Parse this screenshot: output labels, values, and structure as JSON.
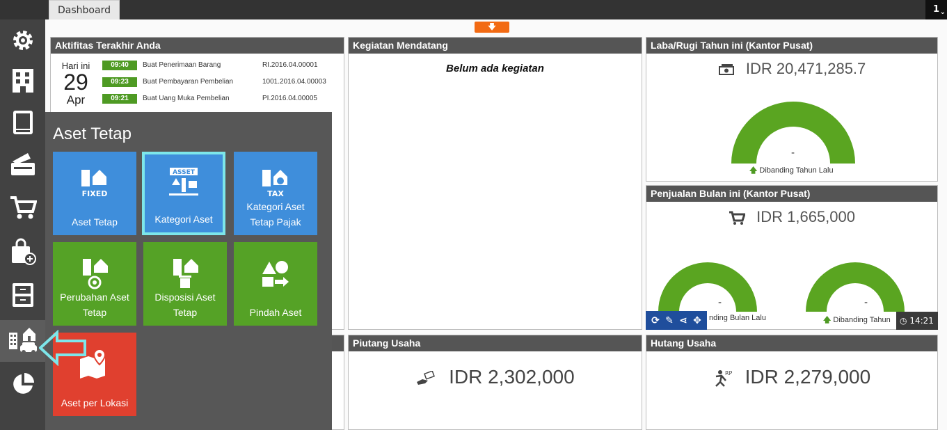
{
  "topbar": {
    "tab_label": "Dashboard",
    "window_num": "1"
  },
  "sidebar": {
    "items": [
      {
        "icon": "gear-icon"
      },
      {
        "icon": "building-icon"
      },
      {
        "icon": "book-icon"
      },
      {
        "icon": "wallet-icon"
      },
      {
        "icon": "cart-icon"
      },
      {
        "icon": "bag-add-icon"
      },
      {
        "icon": "cabinet-icon"
      },
      {
        "icon": "assets-icon"
      },
      {
        "icon": "pie-chart-icon"
      }
    ],
    "active_index": 7
  },
  "panels": {
    "aktifitas": {
      "title": "Aktifitas Terakhir Anda",
      "date_label": "Hari ini",
      "date_day": "29",
      "date_month": "Apr",
      "rows": [
        {
          "time": "09:40",
          "desc": "Buat Penerimaan Barang",
          "ref": "RI.2016.04.00001"
        },
        {
          "time": "09:23",
          "desc": "Buat Pembayaran Pembelian",
          "ref": "1001.2016.04.00003"
        },
        {
          "time": "09:21",
          "desc": "Buat Uang Muka Pembelian",
          "ref": "PI.2016.04.00005"
        }
      ]
    },
    "kegiatan": {
      "title": "Kegiatan Mendatang",
      "empty_text": "Belum ada kegiatan"
    },
    "laba": {
      "title": "Laba/Rugi Tahun ini (Kantor Pusat)",
      "amount": "IDR 20,471,285.7",
      "gauge_value": "-",
      "compare": "Dibanding Tahun Lalu"
    },
    "penjualan": {
      "title": "Penjualan Bulan ini (Kantor Pusat)",
      "amount": "IDR 1,665,000",
      "gauge1_value": "-",
      "gauge2_value": "-",
      "compare1": "nding Bulan Lalu",
      "compare2": "Dibanding Tahun",
      "time": "14:21"
    },
    "piutang": {
      "title": "Piutang Usaha",
      "amount": "IDR 2,302,000"
    },
    "hutang": {
      "title": "Hutang Usaha",
      "amount": "IDR 2,279,000"
    }
  },
  "menu": {
    "title": "Aset Tetap",
    "tiles": [
      {
        "label": "Aset Tetap",
        "badge": "FIXED",
        "color": "#3f8edb"
      },
      {
        "label": "Kategori Aset",
        "badge": "ASSET",
        "color": "#3f8edb",
        "selected": true
      },
      {
        "label": "Kategori Aset Tetap Pajak",
        "badge": "TAX",
        "color": "#3f8edb"
      },
      {
        "label": "Perubahan Aset Tetap",
        "color": "#55a226"
      },
      {
        "label": "Disposisi Aset Tetap",
        "color": "#55a226"
      },
      {
        "label": "Pindah Aset",
        "color": "#55a226"
      },
      {
        "label": "Aset per Lokasi",
        "color": "#e0402f"
      }
    ]
  },
  "colors": {
    "accent_orange": "#f26a13",
    "gauge_green": "#5aa521",
    "tile_blue": "#3f8edb",
    "tile_green": "#55a226",
    "tile_red": "#e0402f",
    "highlight": "#7de6ea"
  }
}
